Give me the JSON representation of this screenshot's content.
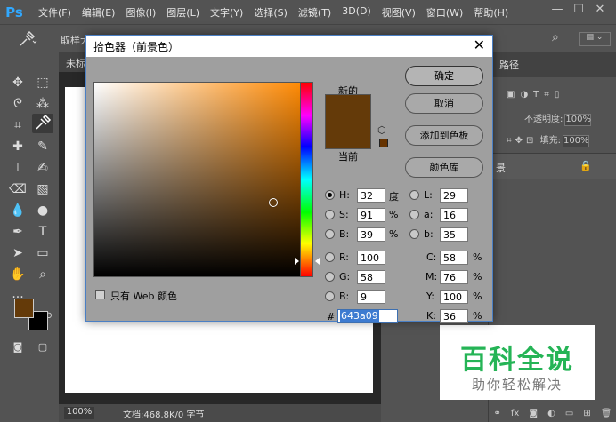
{
  "app": {
    "logo": "Ps",
    "menu": [
      "文件(F)",
      "编辑(E)",
      "图像(I)",
      "图层(L)",
      "文字(Y)",
      "选择(S)",
      "滤镜(T)",
      "3D(D)",
      "视图(V)",
      "窗口(W)",
      "帮助(H)"
    ],
    "window_controls": [
      "—",
      "☐",
      "✕"
    ]
  },
  "options_bar": {
    "sample_label": "取样大"
  },
  "document": {
    "tab_label": "未标",
    "zoom": "100%",
    "doc_info": "文档:468.8K/0 字节"
  },
  "right_panel": {
    "tab": "路径",
    "opacity_label": "不透明度:",
    "opacity_value": "100%",
    "fill_label": "填充:",
    "fill_value": "100%",
    "layer_name": "景"
  },
  "watermark": {
    "title": "百科全说",
    "subtitle": "助你轻松解决"
  },
  "dialog": {
    "title": "拾色器（前景色）",
    "close": "✕",
    "new_label": "新的",
    "current_label": "当前",
    "buttons": {
      "ok": "确定",
      "cancel": "取消",
      "add_swatch": "添加到色板",
      "libraries": "颜色库"
    },
    "fields": {
      "H": {
        "label": "H:",
        "value": "32",
        "unit": "度"
      },
      "S": {
        "label": "S:",
        "value": "91",
        "unit": "%"
      },
      "B": {
        "label": "B:",
        "value": "39",
        "unit": "%"
      },
      "R": {
        "label": "R:",
        "value": "100"
      },
      "G": {
        "label": "G:",
        "value": "58"
      },
      "Bl": {
        "label": "B:",
        "value": "9"
      },
      "L": {
        "label": "L:",
        "value": "29"
      },
      "a": {
        "label": "a:",
        "value": "16"
      },
      "b": {
        "label": "b:",
        "value": "35"
      },
      "C": {
        "label": "C:",
        "value": "58",
        "unit": "%"
      },
      "M": {
        "label": "M:",
        "value": "76",
        "unit": "%"
      },
      "Y": {
        "label": "Y:",
        "value": "100",
        "unit": "%"
      },
      "K": {
        "label": "K:",
        "value": "36",
        "unit": "%"
      }
    },
    "hash": "#",
    "hex": "643a09",
    "web_only_label": "只有 Web 颜色",
    "colors": {
      "current": "#643a09",
      "web_safe": "#663300",
      "hue": "#ff8800"
    }
  }
}
